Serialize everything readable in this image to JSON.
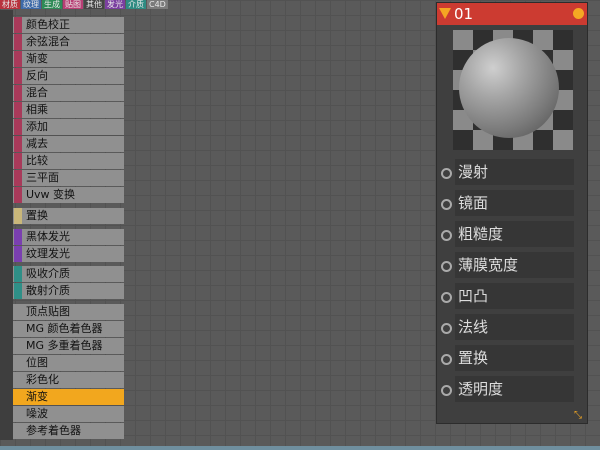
{
  "tabs": [
    {
      "label": "材质",
      "color": "#b8323d"
    },
    {
      "label": "纹理",
      "color": "#3d6aa8"
    },
    {
      "label": "生成",
      "color": "#2e8b57"
    },
    {
      "label": "贴图",
      "color": "#b83e74"
    },
    {
      "label": "其他",
      "color": "#444444"
    },
    {
      "label": "发光",
      "color": "#7b3fa0"
    },
    {
      "label": "介质",
      "color": "#2e8b82"
    },
    {
      "label": "C4D",
      "color": "#7b7b7b"
    }
  ],
  "groups": [
    {
      "items": [
        {
          "label": "颜色校正",
          "color": "#a83a5a"
        },
        {
          "label": "余弦混合",
          "color": "#a83a5a"
        },
        {
          "label": "渐变",
          "color": "#a83a5a"
        },
        {
          "label": "反向",
          "color": "#a83a5a"
        },
        {
          "label": "混合",
          "color": "#a83a5a"
        },
        {
          "label": "相乘",
          "color": "#a83a5a"
        },
        {
          "label": "添加",
          "color": "#a83a5a"
        },
        {
          "label": "减去",
          "color": "#a83a5a"
        },
        {
          "label": "比较",
          "color": "#a83a5a"
        },
        {
          "label": "三平面",
          "color": "#a83a5a"
        },
        {
          "label": "Uvw 变换",
          "color": "#a83a5a"
        }
      ]
    },
    {
      "items": [
        {
          "label": "置换",
          "color": "#c9b77a"
        }
      ]
    },
    {
      "items": [
        {
          "label": "黑体发光",
          "color": "#7a3fb0"
        },
        {
          "label": "纹理发光",
          "color": "#7a3fb0"
        }
      ]
    },
    {
      "items": [
        {
          "label": "吸收介质",
          "color": "#2f8f87"
        },
        {
          "label": "散射介质",
          "color": "#2f8f87"
        }
      ]
    },
    {
      "items": [
        {
          "label": "顶点贴图",
          "color": ""
        },
        {
          "label": "MG 颜色着色器",
          "color": ""
        },
        {
          "label": "MG 多重着色器",
          "color": ""
        },
        {
          "label": "位图",
          "color": ""
        },
        {
          "label": "彩色化",
          "color": ""
        },
        {
          "label": "渐变",
          "color": "",
          "active": true
        },
        {
          "label": "噪波",
          "color": ""
        },
        {
          "label": "参考着色器",
          "color": ""
        }
      ]
    }
  ],
  "node": {
    "title": "01",
    "header_color": "#cc3b31",
    "ports": [
      "漫射",
      "镜面",
      "粗糙度",
      "薄膜宽度",
      "凹凸",
      "法线",
      "置换",
      "透明度"
    ]
  }
}
